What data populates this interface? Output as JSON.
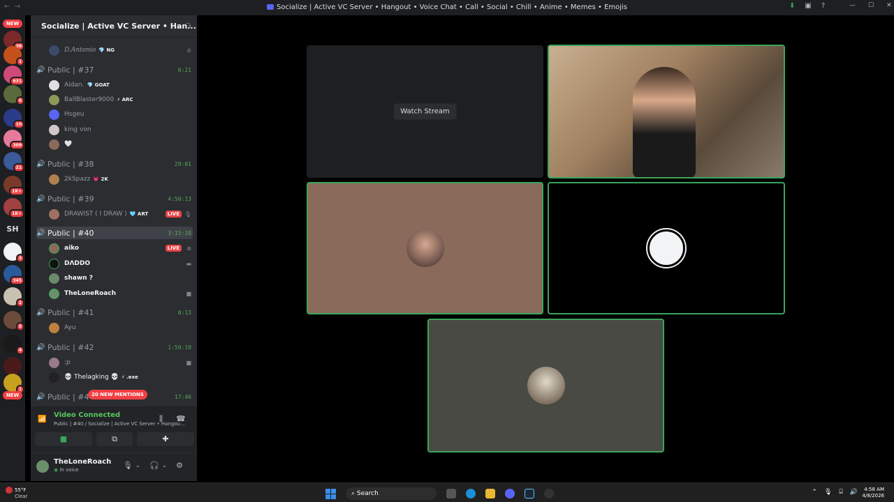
{
  "window": {
    "title": "Socialize | Active VC Server • Hangout • Voice Chat • Call • Social • Chill • Anime • Memes • Emojis"
  },
  "guilds": {
    "new_top": "NEW",
    "new_bottom": "NEW",
    "sh_label": "SH",
    "badges": [
      "38",
      "1",
      "631",
      "6",
      "10",
      "309",
      "21",
      "1K+",
      "1K+",
      "3",
      "345",
      "2",
      "5",
      "4",
      "1"
    ]
  },
  "server": {
    "name": "Socialize | Active VC Server • Han..."
  },
  "channels": [
    {
      "label": "Public | #37",
      "time": "6:21"
    },
    {
      "label": "Public | #38",
      "time": "29:01"
    },
    {
      "label": "Public | #39",
      "time": "4:50:13"
    },
    {
      "label": "Public | #40",
      "time": "3:15:18"
    },
    {
      "label": "Public | #41",
      "time": "0:13"
    },
    {
      "label": "Public | #42",
      "time": "1:59:19"
    },
    {
      "label": "Public | #4",
      "time": "17:46"
    }
  ],
  "users": {
    "top": {
      "name": "D.Antonio",
      "tag": "💎 NG"
    },
    "c37": [
      {
        "name": "Aidan.",
        "tag": "💎 GOAT"
      },
      {
        "name": "BallBlaster9000",
        "tag": "⚡ ARC"
      },
      {
        "name": "Hsgeu",
        "tag": ""
      },
      {
        "name": "king von",
        "tag": ""
      },
      {
        "name": "🤍",
        "tag": ""
      }
    ],
    "c38": [
      {
        "name": "2kSpazz",
        "tag": "💗 2K"
      }
    ],
    "c39": [
      {
        "name": "DRAWIST ( I DRAW )",
        "tag": "🩵 ART",
        "live": "LIVE"
      }
    ],
    "c40": [
      {
        "name": "aiko",
        "live": "LIVE"
      },
      {
        "name": "DΛDDO"
      },
      {
        "name": "shawn ?"
      },
      {
        "name": "TheLoneRoach"
      }
    ],
    "c41": [
      {
        "name": "Ayu"
      }
    ],
    "c42": [
      {
        "name": ":p"
      },
      {
        "name": "💀 Thelagking 💀",
        "tag": "⚡ .exe"
      }
    ]
  },
  "mentions": "20 NEW MENTIONS",
  "voice": {
    "status": "Video Connected",
    "sub": "Public | #40 / Socialize | Active VC Server • Hangou..."
  },
  "me": {
    "name": "TheLoneRoach",
    "status": "In voice"
  },
  "stage": {
    "watch_label": "Watch Stream"
  },
  "taskbar": {
    "temp": "55°F",
    "cond": "Clear",
    "search": "Search",
    "time": "4:58 AM",
    "date": "4/8/2026"
  },
  "colors": {
    "speaking": "#3ba55c",
    "live": "#ed4245",
    "voice_green": "#57a857"
  }
}
